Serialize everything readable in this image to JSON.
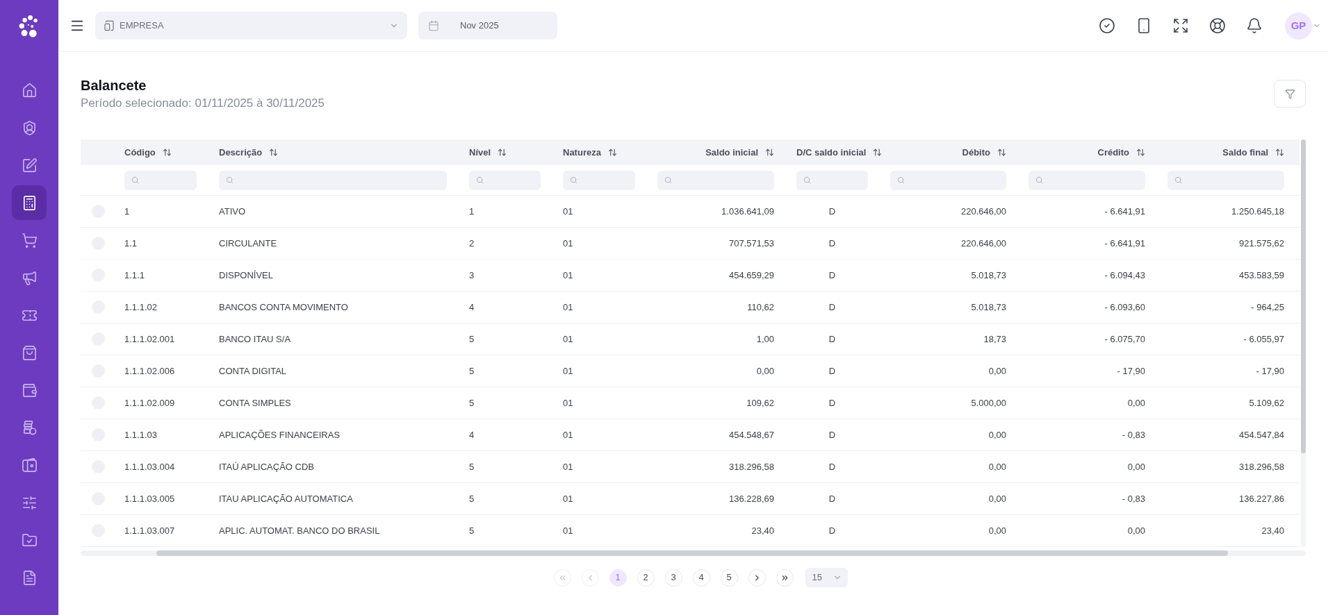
{
  "sidebar": {
    "items": [
      {
        "selected": false
      },
      {
        "selected": false
      },
      {
        "selected": false
      },
      {
        "selected": true
      },
      {
        "selected": false
      },
      {
        "selected": false
      },
      {
        "selected": false
      },
      {
        "selected": false
      },
      {
        "selected": false
      },
      {
        "selected": false
      },
      {
        "selected": false
      },
      {
        "selected": false
      },
      {
        "selected": false
      },
      {
        "selected": false
      }
    ]
  },
  "top_bar": {
    "company_select": {
      "value": "EMPRESA"
    },
    "period_field": {
      "value": "Nov 2025"
    },
    "avatar": {
      "initials": "GP"
    }
  },
  "page": {
    "title": "Balancete",
    "subtitle": "Período selecionado: 01/11/2025 à 30/11/2025"
  },
  "table": {
    "columns": [
      {
        "label": "Código"
      },
      {
        "label": "Descrição"
      },
      {
        "label": "Nível"
      },
      {
        "label": "Natureza"
      },
      {
        "label": "Saldo inicial"
      },
      {
        "label": "D/C saldo inicial"
      },
      {
        "label": "Débito"
      },
      {
        "label": "Crédito"
      },
      {
        "label": "Saldo final"
      }
    ],
    "rows": [
      {
        "selected": false,
        "cells": [
          "1",
          "ATIVO",
          "1",
          "01",
          "1.036.641,09",
          "D",
          "220.646,00",
          "- 6.641,91",
          "1.250.645,18"
        ]
      },
      {
        "selected": false,
        "cells": [
          "1.1",
          "CIRCULANTE",
          "2",
          "01",
          "707.571,53",
          "D",
          "220.646,00",
          "- 6.641,91",
          "921.575,62"
        ]
      },
      {
        "selected": false,
        "cells": [
          "1.1.1",
          "DISPONÍVEL",
          "3",
          "01",
          "454.659,29",
          "D",
          "5.018,73",
          "- 6.094,43",
          "453.583,59"
        ]
      },
      {
        "selected": false,
        "cells": [
          "1.1.1.02",
          "BANCOS CONTA MOVIMENTO",
          "4",
          "01",
          "110,62",
          "D",
          "5.018,73",
          "- 6.093,60",
          "- 964,25"
        ]
      },
      {
        "selected": false,
        "cells": [
          "1.1.1.02.001",
          "BANCO ITAU S/A",
          "5",
          "01",
          "1,00",
          "D",
          "18,73",
          "- 6.075,70",
          "- 6.055,97"
        ]
      },
      {
        "selected": false,
        "cells": [
          "1.1.1.02.006",
          "CONTA DIGITAL",
          "5",
          "01",
          "0,00",
          "D",
          "0,00",
          "- 17,90",
          "- 17,90"
        ]
      },
      {
        "selected": false,
        "cells": [
          "1.1.1.02.009",
          "CONTA SIMPLES",
          "5",
          "01",
          "109,62",
          "D",
          "5.000,00",
          "0,00",
          "5.109,62"
        ]
      },
      {
        "selected": false,
        "cells": [
          "1.1.1.03",
          "APLICAÇÕES FINANCEIRAS",
          "4",
          "01",
          "454.548,67",
          "D",
          "0,00",
          "- 0,83",
          "454.547,84"
        ]
      },
      {
        "selected": false,
        "cells": [
          "1.1.1.03.004",
          "ITAÚ APLICAÇÃO CDB",
          "5",
          "01",
          "318.296,58",
          "D",
          "0,00",
          "0,00",
          "318.296,58"
        ]
      },
      {
        "selected": false,
        "cells": [
          "1.1.1.03.005",
          "ITAU APLICAÇÃO AUTOMATICA",
          "5",
          "01",
          "136.228,69",
          "D",
          "0,00",
          "- 0,83",
          "136.227,86"
        ]
      },
      {
        "selected": false,
        "cells": [
          "1.1.1.03.007",
          "APLIC. AUTOMAT. BANCO DO BRASIL",
          "5",
          "01",
          "23,40",
          "D",
          "0,00",
          "0,00",
          "23,40"
        ]
      }
    ]
  },
  "pagination": {
    "first": {
      "disabled": true
    },
    "previous": {
      "disabled": true
    },
    "pages": [
      {
        "label": "1",
        "selected": true
      },
      {
        "label": "2",
        "selected": false
      },
      {
        "label": "3",
        "selected": false
      },
      {
        "label": "4",
        "selected": false
      },
      {
        "label": "5",
        "selected": false
      }
    ],
    "next": {
      "disabled": false
    },
    "last": {
      "disabled": false
    },
    "page_size": "15"
  }
}
